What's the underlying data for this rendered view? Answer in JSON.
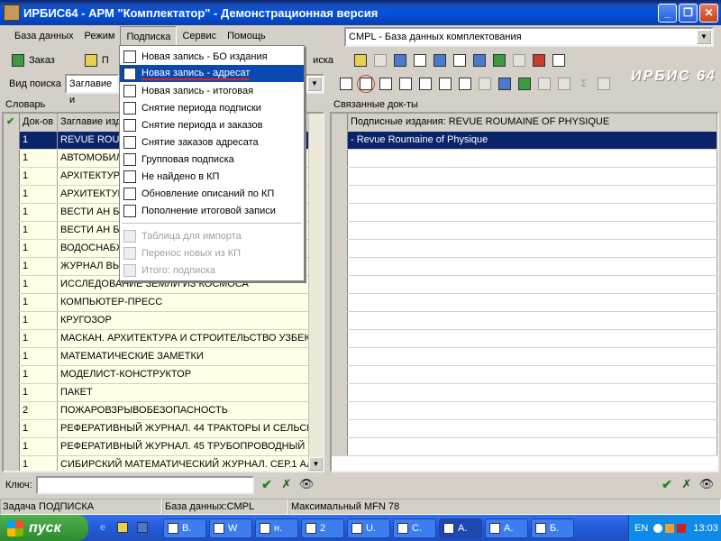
{
  "window": {
    "title": "ИРБИС64 - АРМ \"Комплектатор\" - Демонстрационная версия",
    "logo_text": "ИРБИС 64"
  },
  "menubar": {
    "items": [
      "База данных",
      "Режим",
      "Подписка",
      "Сервис",
      "Помощь"
    ]
  },
  "database_select": {
    "value": "CMPL - База данных комплектования"
  },
  "toolbar": {
    "order_label": "Заказ",
    "order_partial": "П",
    "search_partial": "иска"
  },
  "search": {
    "label": "Вид поиска",
    "value": "Заглавие и"
  },
  "dictionary": {
    "label": "Словарь",
    "col_count": "Док-ов",
    "col_title": "Заглавие изд",
    "rows": [
      {
        "n": "1",
        "t": "REVUE ROUM"
      },
      {
        "n": "1",
        "t": "АВТОМОБИЛ"
      },
      {
        "n": "1",
        "t": "АРХІТЕКТУРА"
      },
      {
        "n": "1",
        "t": "АРХИТЕКТУР"
      },
      {
        "n": "1",
        "t": "ВЕСТИ АН БЕ"
      },
      {
        "n": "1",
        "t": "ВЕСТИ АН БЕ"
      },
      {
        "n": "1",
        "t": "ВОДОСНАБЖ"
      },
      {
        "n": "1",
        "t": "ЖУРНАЛ ВЫ"
      },
      {
        "n": "1",
        "t": "ИССЛЕДОВАНИЕ ЗЕМЛИ ИЗ КОСМОСА"
      },
      {
        "n": "1",
        "t": "КОМПЬЮТЕР-ПРЕСС"
      },
      {
        "n": "1",
        "t": "КРУГОЗОР"
      },
      {
        "n": "1",
        "t": "МАСКАН. АРХИТЕКТУРА И СТРОИТЕЛЬСТВО УЗБЕКИ"
      },
      {
        "n": "1",
        "t": "МАТЕМАТИЧЕСКИЕ ЗАМЕТКИ"
      },
      {
        "n": "1",
        "t": "МОДЕЛИСТ-КОНСТРУКТОР"
      },
      {
        "n": "1",
        "t": "ПАКЕТ"
      },
      {
        "n": "2",
        "t": "ПОЖАРОВЗРЫВОБЕЗОПАСНОСТЬ"
      },
      {
        "n": "1",
        "t": "РЕФЕРАТИВНЫЙ ЖУРНАЛ. 44 ТРАКТОРЫ И СЕЛЬСКО"
      },
      {
        "n": "1",
        "t": "РЕФЕРАТИВНЫЙ ЖУРНАЛ. 45 ТРУБОПРОВОДНЫЙ ТР"
      },
      {
        "n": "1",
        "t": "СИБИРСКИЙ МАТЕМАТИЧЕСКИЙ ЖУРНАЛ. СЕР.1 АЛ"
      }
    ],
    "key_label": "Ключ:"
  },
  "linked": {
    "label": "Связанные док-ты",
    "header": "Подписные издания: REVUE ROUMAINE OF PHYSIQUE",
    "selected_row": "- Revue Roumaine of Physique"
  },
  "dropdown": {
    "items": [
      {
        "label": "Новая запись - БО издания",
        "enabled": true,
        "highlight": false
      },
      {
        "label": "Новая запись - адресат",
        "enabled": true,
        "highlight": true
      },
      {
        "label": "Новая запись - итоговая",
        "enabled": true,
        "highlight": false
      },
      {
        "label": "Снятие периода подписки",
        "enabled": true,
        "highlight": false
      },
      {
        "label": "Снятие периода и заказов",
        "enabled": true,
        "highlight": false
      },
      {
        "label": "Снятие заказов адресата",
        "enabled": true,
        "highlight": false
      },
      {
        "label": "Групповая подписка",
        "enabled": true,
        "highlight": false
      },
      {
        "label": "Не найдено в КП",
        "enabled": true,
        "highlight": false
      },
      {
        "label": "Обновление описаний по КП",
        "enabled": true,
        "highlight": false
      },
      {
        "label": "Пополнение итоговой записи",
        "enabled": true,
        "highlight": false
      },
      {
        "label": "Таблица для импорта",
        "enabled": false,
        "highlight": false
      },
      {
        "label": "Перенос новых из КП",
        "enabled": false,
        "highlight": false
      },
      {
        "label": "Итого: подписка",
        "enabled": false,
        "highlight": false
      }
    ]
  },
  "status": {
    "task": "Задача ПОДПИСКА",
    "db": "База данных:CMPL",
    "mfn": "Максимальный MFN 78"
  },
  "taskbar": {
    "start": "пуск",
    "tasks": [
      "В.",
      "W",
      "н.",
      "2",
      "U.",
      "С.",
      "А.",
      "А.",
      "Б."
    ],
    "lang": "EN",
    "clock": "13:03"
  }
}
